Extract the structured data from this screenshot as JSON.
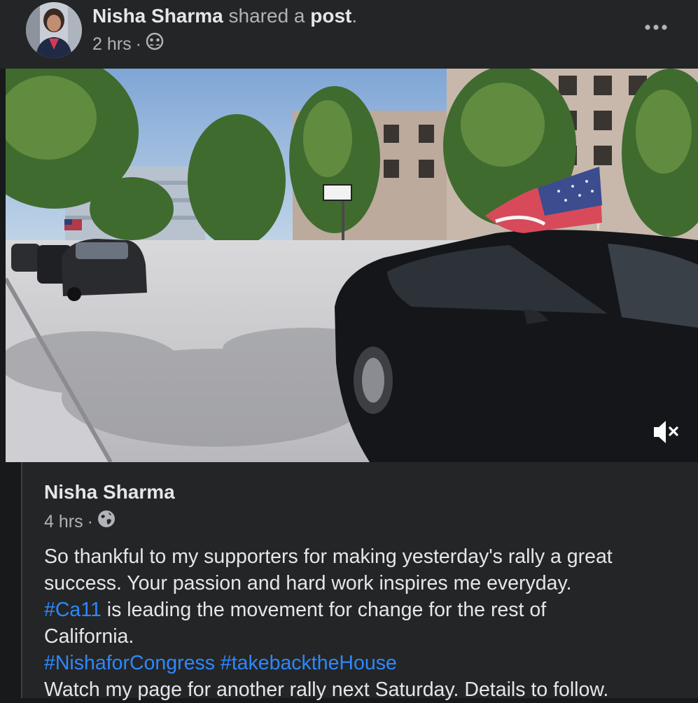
{
  "header": {
    "author_name": "Nisha Sharma",
    "action_text": "shared a",
    "post_link": "post",
    "period": ".",
    "timestamp": "2 hrs",
    "separator": "·",
    "audience_icon": "friends-icon",
    "more_icon": "more-options-icon"
  },
  "video": {
    "mute_icon": "volume-muted-icon"
  },
  "shared_post": {
    "author_name": "Nisha Sharma",
    "timestamp": "4 hrs",
    "separator": "·",
    "audience_icon": "globe-icon",
    "line1": "So thankful to my supporters for making yesterday's rally a great",
    "line2": "success. Your passion and hard work inspires me everyday.",
    "hashtag_ca11": "#Ca11",
    "line3_rest": " is leading the movement for change for the rest of",
    "line4": "California.",
    "hashtag_nisha": "#NishaforCongress",
    "hashtag_space": " ",
    "hashtag_house": "#takebacktheHouse",
    "line6": "Watch my page for another rally next Saturday. Details to follow."
  },
  "colors": {
    "background": "#18191a",
    "surface": "#242526",
    "primary_text": "#e4e6eb",
    "secondary_text": "#b0b3b8",
    "link": "#2d88ff"
  }
}
